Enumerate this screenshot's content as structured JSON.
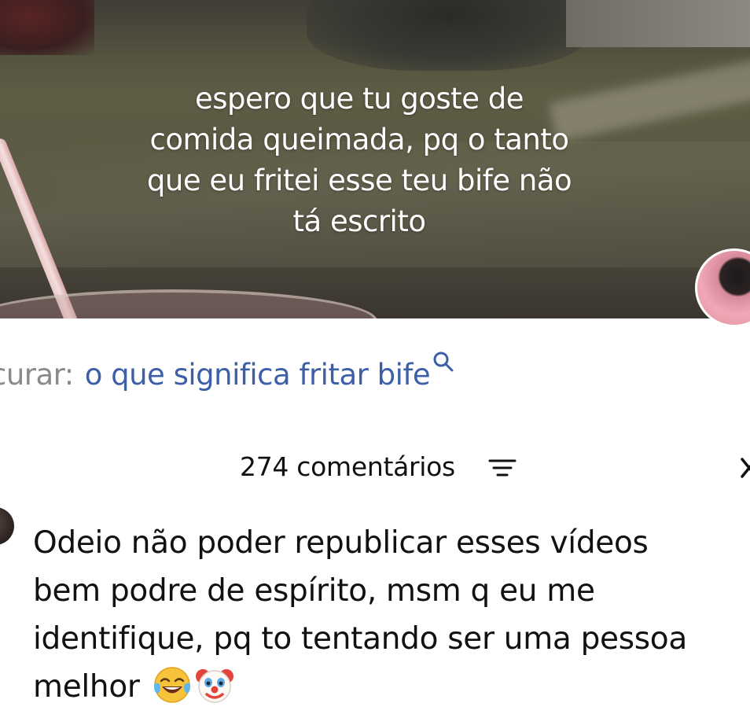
{
  "video": {
    "caption_lines": [
      "espero que tu goste de",
      "comida queimada, pq o tanto",
      "que eu fritei esse teu bife não",
      "tá escrito"
    ]
  },
  "search": {
    "prefix": "curar:",
    "query": "o que significa fritar bife",
    "icon": "search-icon",
    "link_color": "#3d5fa8"
  },
  "comments": {
    "count_label": "274 comentários",
    "filter_icon": "filter-icon",
    "close_icon": "close-icon"
  },
  "comment": {
    "text": "Odeio não poder republicar esses vídeos bem podre de espírito, msm q eu me identifique, pq to tentando ser uma pessoa melhor",
    "line1": "Odeio não poder republicar esses vídeos",
    "line2": "bem podre de espírito, msm q eu me",
    "line3": "identifique, pq to tentando ser uma pessoa",
    "line4": "melhor",
    "emojis": [
      "tears-of-joy-emoji",
      "clown-face-emoji"
    ]
  }
}
